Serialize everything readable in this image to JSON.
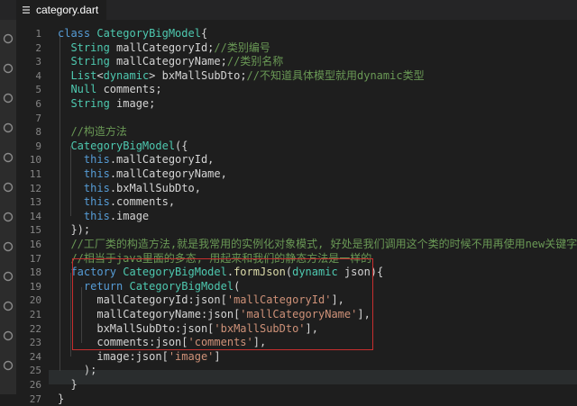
{
  "tab": {
    "label": "category.dart",
    "icon": "hamburger-icon"
  },
  "activity_icons": [
    "circle-icon",
    "circle-icon",
    "circle-icon",
    "circle-icon",
    "circle-icon",
    "circle-icon",
    "circle-icon",
    "circle-icon",
    "circle-icon",
    "circle-icon",
    "circle-icon",
    "circle-icon"
  ],
  "line_numbers": [
    "1",
    "2",
    "3",
    "4",
    "5",
    "6",
    "7",
    "8",
    "9",
    "10",
    "11",
    "12",
    "13",
    "14",
    "15",
    "16",
    "17",
    "18",
    "19",
    "20",
    "21",
    "22",
    "23",
    "24",
    "25",
    "26",
    "27"
  ],
  "code": [
    [
      [
        "kw",
        "class "
      ],
      [
        "ty",
        "CategoryBigModel"
      ],
      [
        "pl",
        "{"
      ]
    ],
    [
      [
        "pl",
        "  "
      ],
      [
        "ty",
        "String"
      ],
      [
        "pl",
        " mallCategoryId;"
      ],
      [
        "cm",
        "//类别编号"
      ]
    ],
    [
      [
        "pl",
        "  "
      ],
      [
        "ty",
        "String"
      ],
      [
        "pl",
        " mallCategoryName;"
      ],
      [
        "cm",
        "//类别名称"
      ]
    ],
    [
      [
        "pl",
        "  "
      ],
      [
        "ty",
        "List"
      ],
      [
        "pl",
        "<"
      ],
      [
        "ty",
        "dynamic"
      ],
      [
        "pl",
        "> bxMallSubDto;"
      ],
      [
        "cm",
        "//不知道具体模型就用dynamic类型"
      ]
    ],
    [
      [
        "pl",
        "  "
      ],
      [
        "ty",
        "Null"
      ],
      [
        "pl",
        " comments;"
      ]
    ],
    [
      [
        "pl",
        "  "
      ],
      [
        "ty",
        "String"
      ],
      [
        "pl",
        " image;"
      ]
    ],
    [],
    [
      [
        "pl",
        "  "
      ],
      [
        "cm",
        "//构造方法"
      ]
    ],
    [
      [
        "pl",
        "  "
      ],
      [
        "ty",
        "CategoryBigModel"
      ],
      [
        "pl",
        "({"
      ]
    ],
    [
      [
        "pl",
        "    "
      ],
      [
        "kw",
        "this"
      ],
      [
        "pl",
        ".mallCategoryId,"
      ]
    ],
    [
      [
        "pl",
        "    "
      ],
      [
        "kw",
        "this"
      ],
      [
        "pl",
        ".mallCategoryName,"
      ]
    ],
    [
      [
        "pl",
        "    "
      ],
      [
        "kw",
        "this"
      ],
      [
        "pl",
        ".bxMallSubDto,"
      ]
    ],
    [
      [
        "pl",
        "    "
      ],
      [
        "kw",
        "this"
      ],
      [
        "pl",
        ".comments,"
      ]
    ],
    [
      [
        "pl",
        "    "
      ],
      [
        "kw",
        "this"
      ],
      [
        "pl",
        ".image"
      ]
    ],
    [
      [
        "pl",
        "  });"
      ]
    ],
    [
      [
        "pl",
        "  "
      ],
      [
        "cm",
        "//工厂类的构造方法,就是我常用的实例化对象模式, 好处是我们调用这个类的时候不用再使用new关键字了"
      ]
    ],
    [
      [
        "pl",
        "  "
      ],
      [
        "cm",
        "//相当于java里面的多态, 用起来和我们的静态方法是一样的"
      ]
    ],
    [
      [
        "pl",
        "  "
      ],
      [
        "kw",
        "factory "
      ],
      [
        "ty",
        "CategoryBigModel"
      ],
      [
        "pl",
        "."
      ],
      [
        "fn",
        "formJson"
      ],
      [
        "pl",
        "("
      ],
      [
        "ty",
        "dynamic"
      ],
      [
        "pl",
        " json){"
      ]
    ],
    [
      [
        "pl",
        "    "
      ],
      [
        "kw",
        "return "
      ],
      [
        "ty",
        "CategoryBigModel"
      ],
      [
        "pl",
        "("
      ]
    ],
    [
      [
        "pl",
        "      mallCategoryId:json["
      ],
      [
        "st",
        "'mallCategoryId'"
      ],
      [
        "pl",
        "],"
      ]
    ],
    [
      [
        "pl",
        "      mallCategoryName:json["
      ],
      [
        "st",
        "'mallCategoryName'"
      ],
      [
        "pl",
        "],"
      ]
    ],
    [
      [
        "pl",
        "      bxMallSubDto:json["
      ],
      [
        "st",
        "'bxMallSubDto'"
      ],
      [
        "pl",
        "],"
      ]
    ],
    [
      [
        "pl",
        "      comments:json["
      ],
      [
        "st",
        "'comments'"
      ],
      [
        "pl",
        "],"
      ]
    ],
    [
      [
        "pl",
        "      image:json["
      ],
      [
        "st",
        "'image'"
      ],
      [
        "pl",
        "]"
      ]
    ],
    [
      [
        "pl",
        "    );"
      ]
    ],
    [
      [
        "pl",
        "  }"
      ]
    ],
    [
      [
        "pl",
        "}"
      ]
    ]
  ],
  "colors": {
    "keyword": "#569cd6",
    "type": "#4ec9b0",
    "string": "#ce9178",
    "comment": "#6a9955",
    "highlight_border": "#c72e2e"
  }
}
